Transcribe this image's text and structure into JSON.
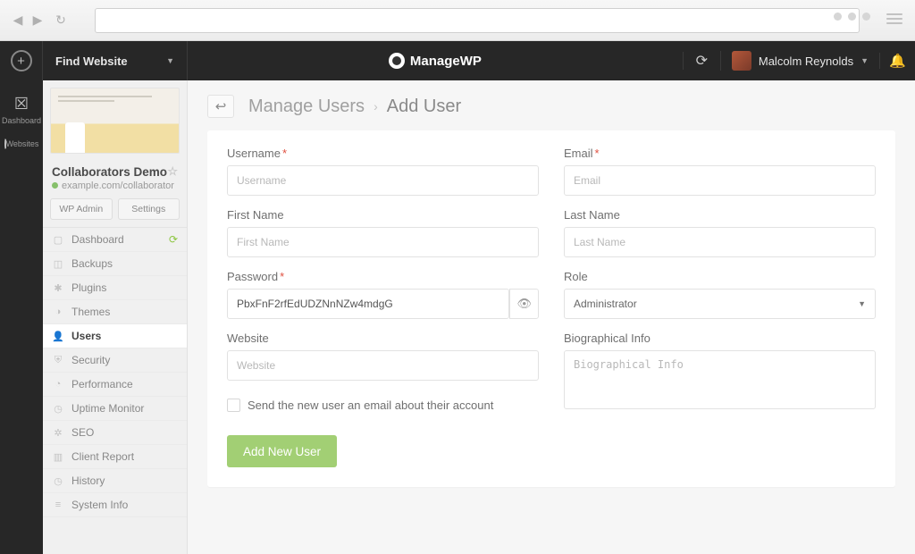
{
  "chrome": {},
  "header": {
    "find_label": "Find Website",
    "brand": "ManageWP",
    "user_name": "Malcolm Reynolds"
  },
  "rail": {
    "dashboard": "Dashboard",
    "websites": "Websites"
  },
  "sidebar": {
    "site_name": "Collaborators Demo",
    "site_url": "example.com/collaborator",
    "wp_admin": "WP Admin",
    "settings": "Settings",
    "items": [
      "Dashboard",
      "Backups",
      "Plugins",
      "Themes",
      "Users",
      "Security",
      "Performance",
      "Uptime Monitor",
      "SEO",
      "Client Report",
      "History",
      "System Info"
    ]
  },
  "crumbs": {
    "parent": "Manage Users",
    "current": "Add User"
  },
  "form": {
    "username_label": "Username",
    "username_placeholder": "Username",
    "email_label": "Email",
    "email_placeholder": "Email",
    "firstname_label": "First Name",
    "firstname_placeholder": "First Name",
    "lastname_label": "Last Name",
    "lastname_placeholder": "Last Name",
    "password_label": "Password",
    "password_value": "PbxFnF2rfEdUDZNnNZw4mdgG",
    "role_label": "Role",
    "role_value": "Administrator",
    "website_label": "Website",
    "website_placeholder": "Website",
    "bio_label": "Biographical Info",
    "bio_placeholder": "Biographical Info",
    "send_email_label": "Send the new user an email about their account",
    "submit": "Add New User"
  }
}
